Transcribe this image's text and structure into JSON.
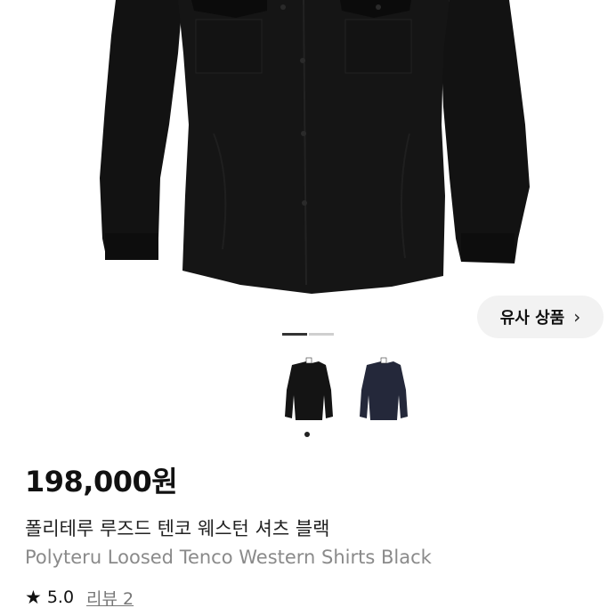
{
  "product": {
    "price": "198,000원",
    "title_ko": "폴리테루 루즈드 텐코 웨스턴 셔츠 블랙",
    "title_en": "Polyteru Loosed Tenco Western Shirts Black",
    "rating": "5.0",
    "review_label": "리뷰 2"
  },
  "similar": {
    "label": "유사 상품",
    "chevron": "›"
  },
  "gallery": {
    "total_images": 2,
    "current_index": 1,
    "thumbnails": [
      {
        "color_name": "black",
        "color": "#141414",
        "selected": true
      },
      {
        "color_name": "navy",
        "color": "#24283a",
        "selected": false
      }
    ]
  },
  "colors": {
    "shirt": "#121212",
    "shirt_shadow": "#050505",
    "indicator_active": "#333333",
    "indicator_inactive": "#cfcfcf"
  },
  "icons": {
    "rating": "star-icon",
    "similar": "chevron-right-icon"
  }
}
